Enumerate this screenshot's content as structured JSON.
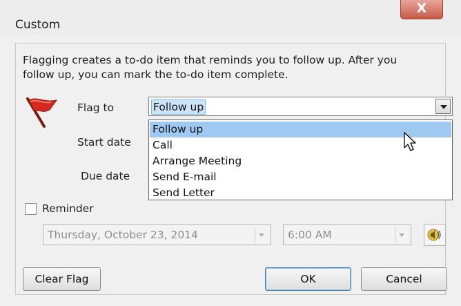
{
  "window": {
    "title": "Custom",
    "close_label": "X"
  },
  "description": "Flagging creates a to-do item that reminds you to follow up. After you follow up, you can mark the to-do item complete.",
  "labels": {
    "flag_to": "Flag to",
    "start_date": "Start date",
    "due_date": "Due date",
    "reminder": "Reminder"
  },
  "flag_to": {
    "value": "Follow up",
    "options": [
      "Follow up",
      "Call",
      "Arrange Meeting",
      "Send E-mail",
      "Send Letter"
    ],
    "highlighted_index": 0
  },
  "reminder": {
    "checked": false,
    "date": "Thursday, October 23, 2014",
    "time": "6:00 AM"
  },
  "buttons": {
    "clear_flag": "Clear Flag",
    "ok": "OK",
    "cancel": "Cancel"
  },
  "icons": {
    "flag": "flag-icon",
    "sound": "sound-icon",
    "cursor": "mouse-cursor-icon",
    "close": "close-icon"
  },
  "colors": {
    "flag_red": "#d42a1e",
    "highlight": "#9fc9f0",
    "close_button": "#c85a47"
  }
}
